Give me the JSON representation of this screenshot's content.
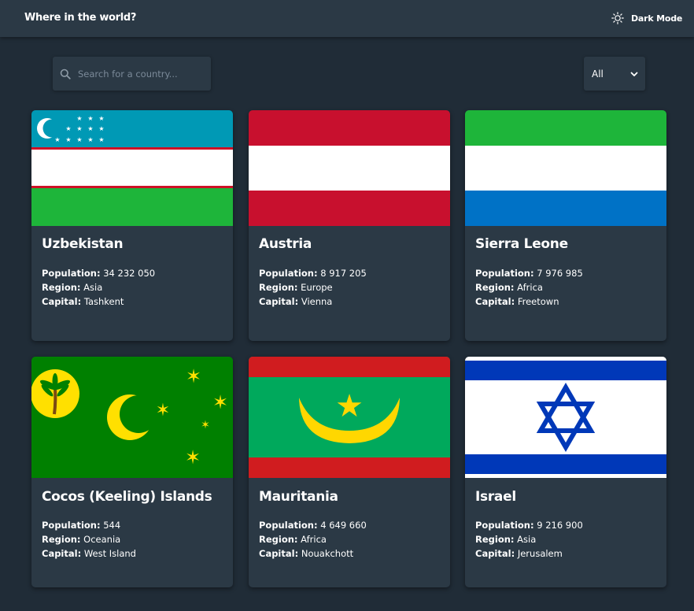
{
  "header": {
    "title": "Where in the world?",
    "theme_toggle_label": "Dark Mode"
  },
  "search": {
    "placeholder": "Search for a country...",
    "value": ""
  },
  "filter": {
    "selected": "All"
  },
  "labels": {
    "population": "Population:",
    "region": "Region:",
    "capital": "Capital:"
  },
  "countries": [
    {
      "name": "Uzbekistan",
      "population": "34 232 050",
      "region": "Asia",
      "capital": "Tashkent"
    },
    {
      "name": "Austria",
      "population": "8 917 205",
      "region": "Europe",
      "capital": "Vienna"
    },
    {
      "name": "Sierra Leone",
      "population": "7 976 985",
      "region": "Africa",
      "capital": "Freetown"
    },
    {
      "name": "Cocos (Keeling) Islands",
      "population": "544",
      "region": "Oceania",
      "capital": "West Island"
    },
    {
      "name": "Mauritania",
      "population": "4 649 660",
      "region": "Africa",
      "capital": "Nouakchott"
    },
    {
      "name": "Israel",
      "population": "9 216 900",
      "region": "Asia",
      "capital": "Jerusalem"
    }
  ],
  "colors": {
    "background": "#202c37",
    "element": "#2b3945",
    "text": "#ffffff",
    "placeholder": "#7b8a99"
  }
}
